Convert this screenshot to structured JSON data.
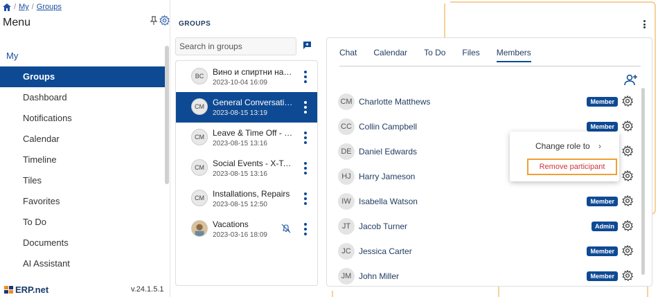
{
  "breadcrumb": {
    "home_icon": "home-icon",
    "items": [
      "My",
      "Groups"
    ]
  },
  "menu": {
    "title": "Menu",
    "section": "My",
    "items": [
      {
        "label": "Groups",
        "active": true
      },
      {
        "label": "Dashboard"
      },
      {
        "label": "Notifications"
      },
      {
        "label": "Calendar"
      },
      {
        "label": "Timeline"
      },
      {
        "label": "Tiles"
      },
      {
        "label": "Favorites"
      },
      {
        "label": "To Do"
      },
      {
        "label": "Documents"
      },
      {
        "label": "AI Assistant"
      }
    ],
    "brand": "ERP.net",
    "version": "v.24.1.5.1"
  },
  "groups": {
    "title": "GROUPS",
    "search_placeholder": "Search in groups",
    "items": [
      {
        "avatar": "BC",
        "name": "Вино и спиртни напитки",
        "date": "2023-10-04 16:09"
      },
      {
        "avatar": "CM",
        "name": "General Conversations",
        "date": "2023-08-15 13:19",
        "active": true
      },
      {
        "avatar": "CM",
        "name": "Leave & Time Off - Requests",
        "date": "2023-08-15 13:16"
      },
      {
        "avatar": "CM",
        "name": "Social Events - X-Team",
        "date": "2023-08-15 13:16"
      },
      {
        "avatar": "CM",
        "name": "Installations, Repairs",
        "date": "2023-08-15 12:50"
      },
      {
        "avatar": "",
        "name": "Vacations",
        "date": "2023-03-16 18:09",
        "muted": true
      }
    ]
  },
  "tabs": [
    "Chat",
    "Calendar",
    "To Do",
    "Files",
    "Members"
  ],
  "active_tab": "Members",
  "members": [
    {
      "initials": "CM",
      "name": "Charlotte Matthews",
      "role": "Member"
    },
    {
      "initials": "CC",
      "name": "Collin Campbell",
      "role": "Member"
    },
    {
      "initials": "DE",
      "name": "Daniel Edwards",
      "role": ""
    },
    {
      "initials": "HJ",
      "name": "Harry Jameson",
      "role": ""
    },
    {
      "initials": "IW",
      "name": "Isabella Watson",
      "role": "Member"
    },
    {
      "initials": "JT",
      "name": "Jacob Turner",
      "role": "Admin"
    },
    {
      "initials": "JC",
      "name": "Jessica Carter",
      "role": "Member"
    },
    {
      "initials": "JM",
      "name": "John Miller",
      "role": "Member"
    }
  ],
  "popup": {
    "change_role": "Change role to",
    "chevron": "›",
    "remove": "Remove participant"
  },
  "colors": {
    "primary": "#0e4a94",
    "highlight": "#f0a030",
    "danger": "#d0343a"
  }
}
